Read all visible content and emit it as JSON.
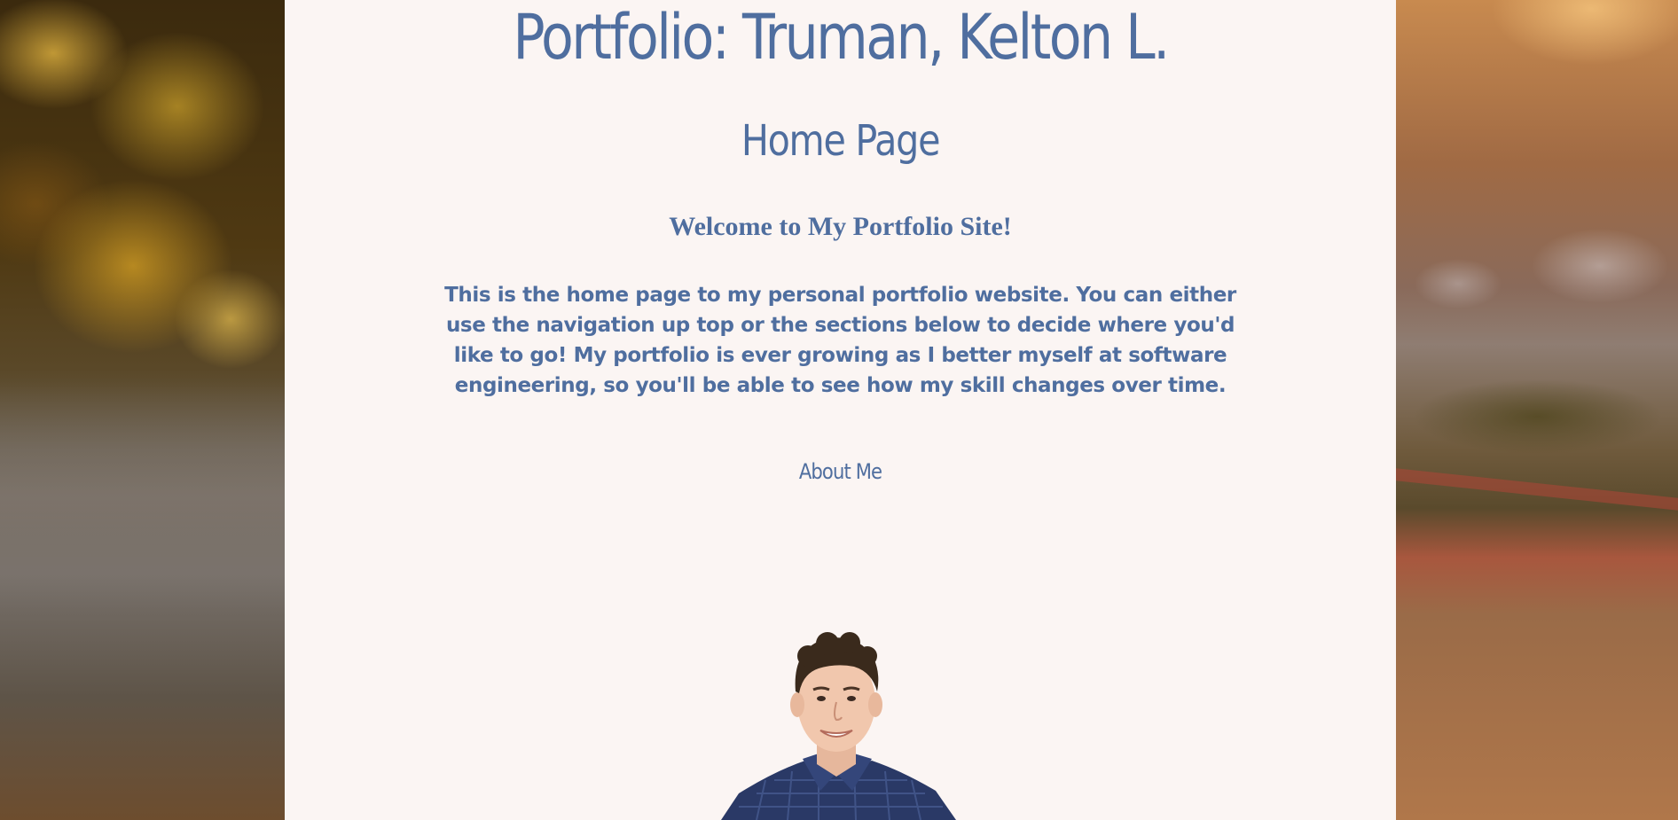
{
  "header": {
    "title": "Portfolio: Truman, Kelton L."
  },
  "main": {
    "page_heading": "Home Page",
    "welcome": "Welcome to My Portfolio Site!",
    "intro": "This is the home page to my personal portfolio website. You can either use the navigation up top or the sections below to decide where you'd like to go! My portfolio is ever growing as I better myself at software engineering, so you'll be able to see how my skill changes over time.",
    "sections": [
      {
        "label": "About Me"
      }
    ]
  },
  "colors": {
    "accent": "#4f6e9f",
    "panel_background": "#fbf5f3"
  }
}
